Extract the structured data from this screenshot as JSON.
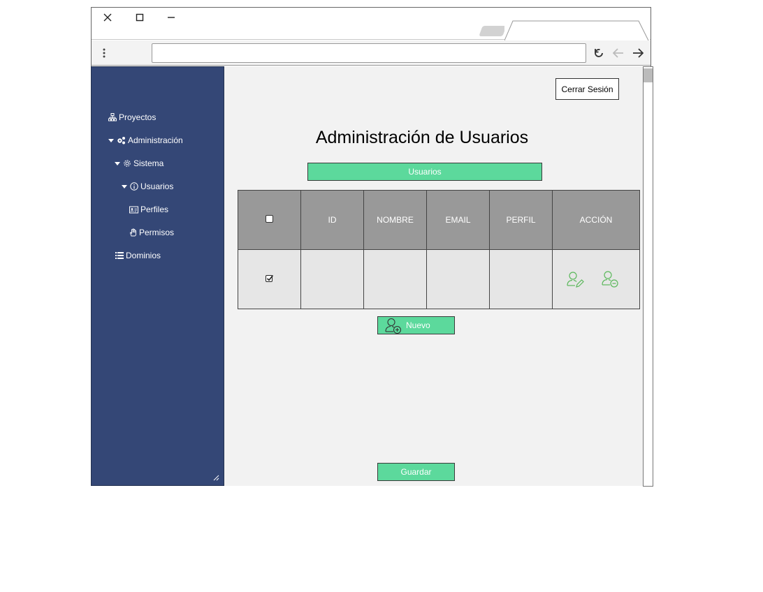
{
  "browser": {
    "window_controls": {
      "close": "close-icon",
      "maximize": "maximize-icon",
      "minimize": "minimize-icon"
    },
    "address_bar": {
      "value": ""
    },
    "nav_icons": [
      "menu-dots-icon",
      "reload-icon",
      "back-icon",
      "forward-icon"
    ]
  },
  "sidebar": {
    "items": [
      {
        "label": "Proyectos",
        "icon": "sitemap-icon"
      },
      {
        "label": "Administración",
        "icon": "gears-icon",
        "expanded": true
      },
      {
        "label": "Sistema",
        "icon": "gear-icon",
        "expanded": true
      },
      {
        "label": "Usuarios",
        "icon": "info-circle-icon",
        "expanded": true
      },
      {
        "label": "Perfiles",
        "icon": "id-card-icon"
      },
      {
        "label": "Permisos",
        "icon": "hand-icon"
      },
      {
        "label": "Dominios",
        "icon": "list-icon"
      }
    ]
  },
  "header": {
    "logout_label": "Cerrar Sesión"
  },
  "main": {
    "title": "Administración de Usuarios",
    "section_label": "Usuarios",
    "table": {
      "columns": [
        "ID",
        "NOMBRE",
        "EMAIL",
        "PERFIL",
        "ACCIÓN"
      ],
      "rows": [
        {
          "checked": true,
          "id": "",
          "nombre": "",
          "email": "",
          "perfil": ""
        }
      ]
    },
    "new_button_label": "Nuevo",
    "save_button_label": "Guardar"
  },
  "colors": {
    "sidebar": "#344776",
    "accent_green": "#5cd99c",
    "table_header": "#999999",
    "table_cell": "#e6e6e6",
    "content_bg": "#f2f2f2",
    "icon_green": "#5cb85c"
  }
}
